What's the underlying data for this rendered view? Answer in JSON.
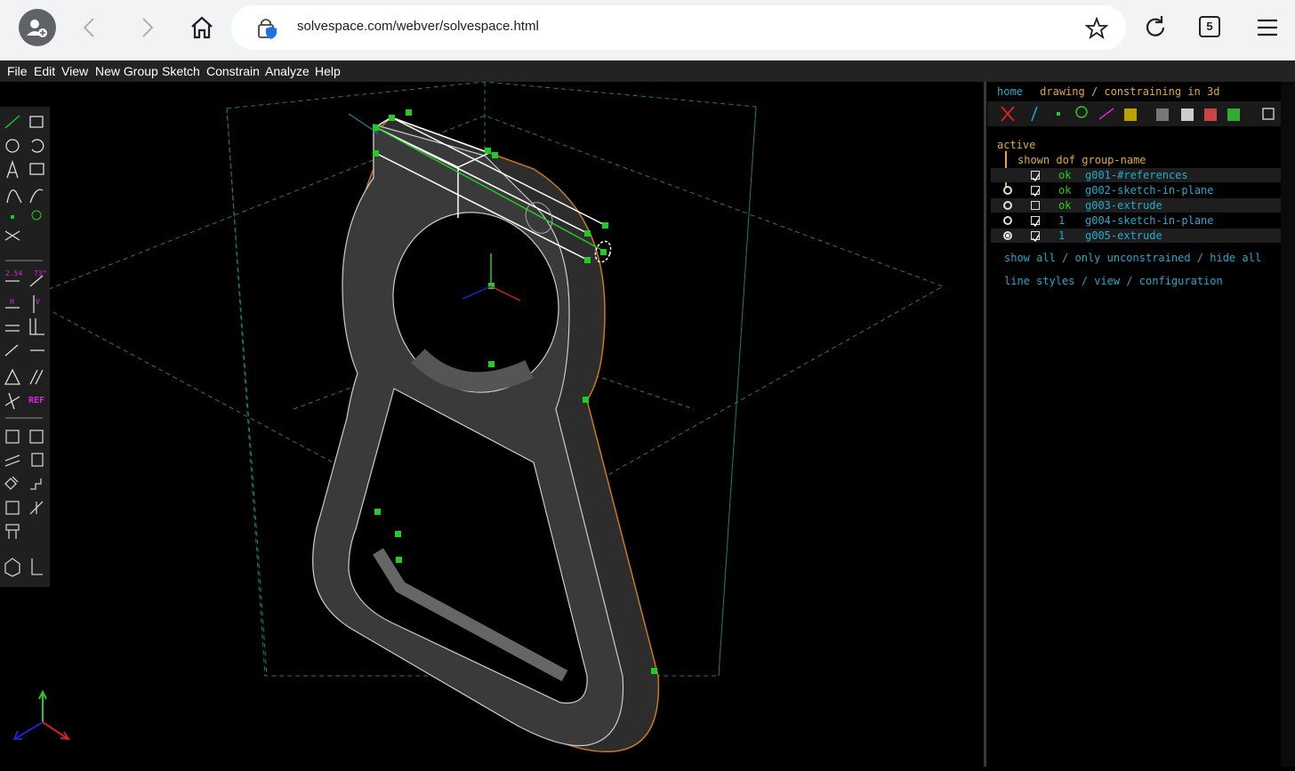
{
  "browser": {
    "url": "solvespace.com/webver/solvespace.html",
    "tab_count": "5"
  },
  "menu": [
    "File",
    "Edit",
    "View",
    "New Group",
    "Sketch",
    "Constrain",
    "Analyze",
    "Help"
  ],
  "toolbar": {
    "dimension_label": "2.54",
    "angle_label": "73°",
    "horizontal_label": "H",
    "vertical_label": "V",
    "ref_label": "REF"
  },
  "panel": {
    "breadcrumb_home": "home",
    "breadcrumb_sep": "/",
    "breadcrumb_title": "drawing / constraining in 3d",
    "active_label": "active",
    "col_shown": "shown",
    "col_dof": "dof",
    "col_name": "group-name",
    "groups": [
      {
        "name": "g001-#references",
        "dof": "ok",
        "shown": true,
        "active": false,
        "has_radio": false
      },
      {
        "name": "g002-sketch-in-plane",
        "dof": "ok",
        "shown": true,
        "active": false,
        "has_radio": true
      },
      {
        "name": "g003-extrude",
        "dof": "ok",
        "shown": false,
        "active": false,
        "has_radio": true
      },
      {
        "name": "g004-sketch-in-plane",
        "dof": "1",
        "shown": true,
        "active": false,
        "has_radio": true
      },
      {
        "name": "g005-extrude",
        "dof": "1",
        "shown": true,
        "active": true,
        "has_radio": true
      }
    ],
    "show_all": "show all",
    "only_unconstrained": "only unconstrained",
    "hide_all": "hide all",
    "line_styles": "line styles",
    "view": "view",
    "configuration": "configuration",
    "sep": "/"
  }
}
